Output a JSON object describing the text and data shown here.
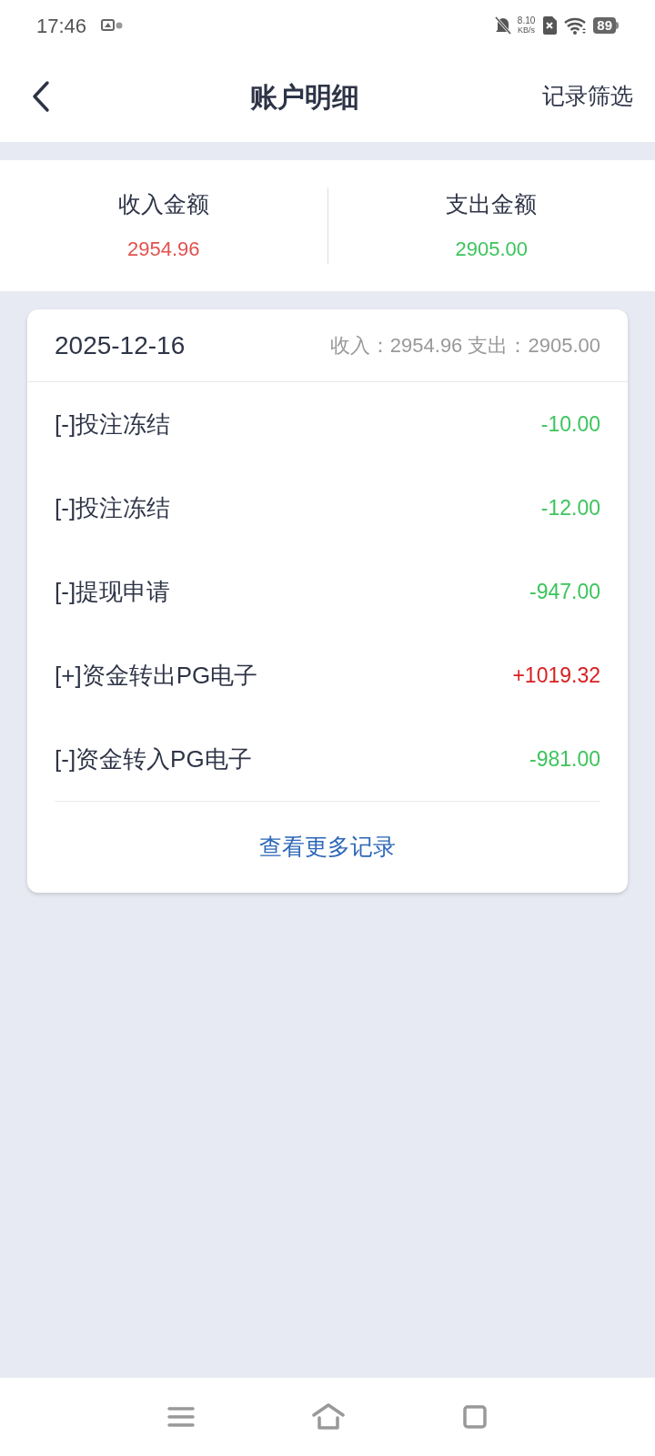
{
  "status_bar": {
    "time": "17:46",
    "speed": "8.10",
    "speed_unit": "KB/s",
    "battery": "89"
  },
  "header": {
    "title": "账户明细",
    "action": "记录筛选"
  },
  "summary": [
    {
      "label": "收入金额",
      "value": "2954.96",
      "kind": "income"
    },
    {
      "label": "支出金额",
      "value": "2905.00",
      "kind": "expense"
    }
  ],
  "day_card": {
    "date": "2025-12-16",
    "totals": "收入：2954.96 支出：2905.00",
    "records": [
      {
        "title": "[-]投注冻结",
        "amount": "-10.00",
        "kind": "expense"
      },
      {
        "title": "[-]投注冻结",
        "amount": "-12.00",
        "kind": "expense"
      },
      {
        "title": "[-]提现申请",
        "amount": "-947.00",
        "kind": "expense"
      },
      {
        "title": "[+]资金转出PG电子",
        "amount": "+1019.32",
        "kind": "income"
      },
      {
        "title": "[-]资金转入PG电子",
        "amount": "-981.00",
        "kind": "expense"
      }
    ],
    "more_link": "查看更多记录"
  }
}
